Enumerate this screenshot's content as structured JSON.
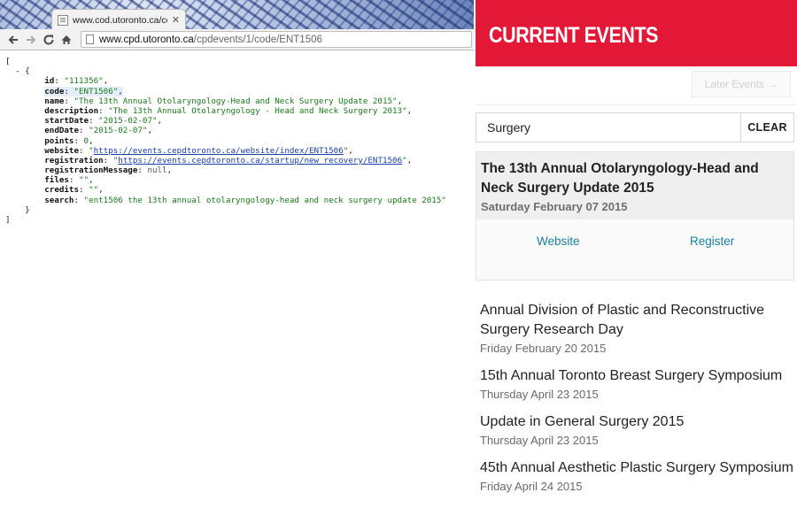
{
  "browser": {
    "tab_title": "www.cod.utoronto.ca/code",
    "url_host": "www.cpd.utoronto.ca",
    "url_path": "/cpdevents/1/code/ENT1506"
  },
  "json_lines": [
    {
      "text": "["
    },
    {
      "text": "  - {"
    },
    {
      "key": "id",
      "val": "\"111356\"",
      "end": ","
    },
    {
      "key": "code",
      "val": "\"ENT1506\"",
      "end": ",",
      "hl": true
    },
    {
      "key": "name",
      "val": "\"The 13th Annual Otolaryngology-Head and Neck Surgery Update 2015\"",
      "end": ","
    },
    {
      "key": "description",
      "val": "\"The 13th Annual Otolaryngology - Head and Neck Surgery 2013\"",
      "end": ","
    },
    {
      "key": "startDate",
      "val": "\"2015-02-07\"",
      "end": ","
    },
    {
      "key": "endDate",
      "val": "\"2015-02-07\"",
      "end": ","
    },
    {
      "key": "points",
      "val": "0",
      "end": ","
    },
    {
      "key": "website",
      "val": "\"https://events.cepdtoronto.ca/website/index/ENT1506\"",
      "end": ",",
      "link": true
    },
    {
      "key": "registration",
      "val": "\"https://events.cepdtoronto.ca/startup/new_recovery/ENT1506\"",
      "end": ",",
      "link": true
    },
    {
      "key": "registrationMessage",
      "val": "null",
      "end": ",",
      "nul": true
    },
    {
      "key": "files",
      "val": "\"\"",
      "end": ","
    },
    {
      "key": "credits",
      "val": "\"\"",
      "end": ","
    },
    {
      "key": "search",
      "val": "\"ent1506 the 13th annual otolaryngology-head and neck surgery update 2015\"",
      "end": ""
    },
    {
      "text": "    }"
    },
    {
      "text": "]"
    }
  ],
  "panel": {
    "banner": "CURRENT EVENTS",
    "later_button": "Later Events →",
    "search_value": "Surgery",
    "clear_button": "CLEAR",
    "featured": {
      "title": "The 13th Annual Otolaryngology-Head and Neck Surgery Update 2015",
      "date": "Saturday February 07 2015",
      "website_label": "Website",
      "register_label": "Register"
    },
    "events": [
      {
        "title": "Annual Division of Plastic and Reconstructive Surgery Research Day",
        "date": "Friday February 20 2015"
      },
      {
        "title": "15th Annual Toronto Breast Surgery Symposium",
        "date": "Thursday April 23 2015"
      },
      {
        "title": "Update in General Surgery 2015",
        "date": "Thursday April 23 2015"
      },
      {
        "title": "45th Annual Aesthetic Plastic Surgery Symposium",
        "date": "Friday April 24 2015"
      }
    ]
  }
}
